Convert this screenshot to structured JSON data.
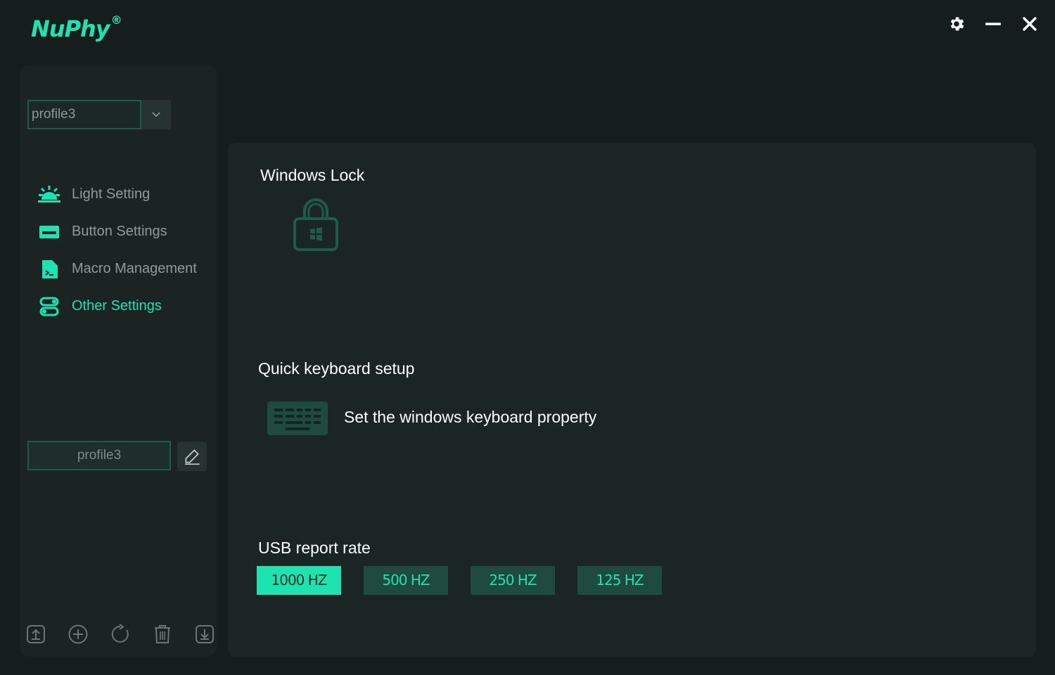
{
  "app": {
    "logo_text": "NuPhy",
    "logo_mark": "®",
    "accent_color": "#1de3b0"
  },
  "window_controls": [
    "gear-icon",
    "minimize-icon",
    "close-icon"
  ],
  "sidebar": {
    "profile_select": {
      "value": "profile3"
    },
    "nav": [
      {
        "label": "Light Setting",
        "icon": "sunrise-icon",
        "active": false
      },
      {
        "label": "Button Settings",
        "icon": "keyboard-key-icon",
        "active": false
      },
      {
        "label": "Macro Management",
        "icon": "macro-file-icon",
        "active": false
      },
      {
        "label": "Other Settings",
        "icon": "toggles-icon",
        "active": true
      }
    ],
    "profile_name": "profile3",
    "bottom_tools": [
      "export-icon",
      "add-icon",
      "reset-icon",
      "delete-icon",
      "import-icon"
    ]
  },
  "main": {
    "windows_lock_title": "Windows Lock",
    "quick_setup_title": "Quick keyboard setup",
    "quick_setup_label": "Set the windows keyboard property",
    "usb_title": "USB report rate",
    "rates": [
      {
        "label": "1000 HZ",
        "active": true
      },
      {
        "label": "500 HZ",
        "active": false
      },
      {
        "label": "250 HZ",
        "active": false
      },
      {
        "label": "125 HZ",
        "active": false
      }
    ]
  }
}
